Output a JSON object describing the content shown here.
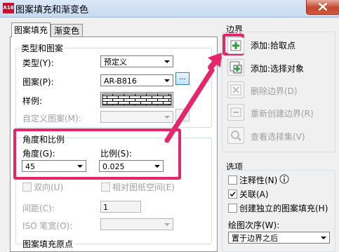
{
  "window": {
    "title": "图案填充和渐变色",
    "app_icon": "A16"
  },
  "tabs": [
    {
      "label": "图案填充"
    },
    {
      "label": "渐变色"
    }
  ],
  "type_pattern": {
    "group_label": "类型和图案",
    "type_label": "类型(Y):",
    "type_value": "预定义",
    "pattern_label": "图案(P):",
    "pattern_value": "AR-B816",
    "browse_label": "...",
    "sample_label": "样例:",
    "custom_label": "自定义图案(M):",
    "custom_value": ""
  },
  "angle_scale": {
    "group_label": "角度和比例",
    "angle_label": "角度(G):",
    "angle_value": "45",
    "scale_label": "比例(S):",
    "scale_value": "0.025",
    "double_label": "双向(U)",
    "relative_label": "相对图纸空间(E)",
    "spacing_label": "间距(C):",
    "spacing_value": "1",
    "iso_label": "ISO 笔宽(O):",
    "iso_value": ""
  },
  "origin": {
    "group_label": "图案填充原点"
  },
  "boundaries": {
    "group_label": "边界",
    "buttons": [
      {
        "label": "添加:拾取点",
        "icon": "add-pick-points-icon"
      },
      {
        "label": "添加:选择对象",
        "icon": "add-select-objects-icon"
      },
      {
        "label": "删除边界(D)",
        "icon": "remove-boundaries-icon"
      },
      {
        "label": "重新创建边界(R)",
        "icon": "recreate-boundary-icon"
      },
      {
        "label": "查看选择集(V)",
        "icon": "view-selections-icon"
      }
    ]
  },
  "options": {
    "group_label": "选项",
    "annotative_label": "注释性(N)",
    "annotative_checked": false,
    "associative_label": "关联(A)",
    "associative_checked": true,
    "separate_label": "创建独立的图案填充(H)",
    "separate_checked": false,
    "draw_order_label": "绘图次序(W):",
    "draw_order_value": "置于边界之后"
  },
  "colors": {
    "highlight": "#e6266a",
    "accent_green": "#2a9d3a"
  }
}
